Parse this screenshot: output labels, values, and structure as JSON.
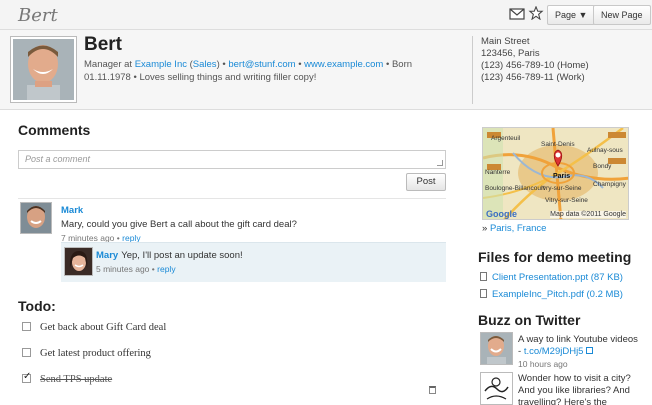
{
  "topbar": {
    "brand": "Bert",
    "page_label": "Page ▼",
    "new_page_label": "New Page"
  },
  "profile": {
    "name": "Bert",
    "role_prefix": "Manager at",
    "company": "Example Inc",
    "dept_open": "(",
    "department": "Sales",
    "dept_close": ")",
    "sep": "•",
    "email": "bert@stunf.com",
    "website": "www.example.com",
    "born_label": "• Born",
    "born_date": "01.11.1978",
    "tagline": "• Loves selling things and writing filler copy!"
  },
  "address": {
    "line1": "Main Street",
    "line2": "123456, Paris",
    "home": "(123) 456-789-10 (Home)",
    "work": "(123) 456-789-11 (Work)"
  },
  "comments": {
    "title": "Comments",
    "placeholder": "Post a comment",
    "post_label": "Post",
    "items": [
      {
        "author": "Mark",
        "text": "Mary, could you give Bert a call about the gift card deal?",
        "time": "7 minutes ago",
        "dot": "•",
        "reply": "reply"
      }
    ],
    "replies": [
      {
        "author": "Mary",
        "text": "Yep, I'll post an update soon!",
        "time": "5 minutes ago",
        "dot": "•",
        "reply": "reply"
      }
    ]
  },
  "todo": {
    "title": "Todo:",
    "items": [
      {
        "text": "Get back about Gift Card deal",
        "done": false
      },
      {
        "text": "Get latest product offering",
        "done": false
      },
      {
        "text": "Send TPS update",
        "done": true
      }
    ]
  },
  "map": {
    "labels": [
      "Argenteuil",
      "Saint-Denis",
      "Aulnay-sous",
      "Bondy",
      "Paris",
      "Boulogne-Billancourt",
      "Ivry-sur-Seine",
      "Vitry-sur-Seine",
      "Champigny",
      "Nanterre"
    ],
    "credit": "Map data ©2011 Google",
    "google": "Google",
    "location_prefix": "»",
    "location": "Paris, France"
  },
  "files": {
    "title": "Files for demo meeting",
    "items": [
      "Client Presentation.ppt (87 KB)",
      "ExampleInc_Pitch.pdf (0.2 MB)"
    ]
  },
  "buzz": {
    "title": "Buzz on Twitter",
    "tweets": [
      {
        "text": "A way to link Youtube videos -",
        "link": "t.co/M29jDHj5",
        "time": "10 hours ago"
      },
      {
        "text": "Wonder how to visit a city? And you like libraries? And travelling? Here's the"
      }
    ]
  },
  "colors": {
    "link": "#1a8ad6",
    "reply_bg": "#eaf2f6",
    "header_bg": "#f6f6f6"
  },
  "icons": [
    "envelope-icon",
    "star-icon",
    "file-icon",
    "trash-icon",
    "external-link-icon",
    "map-pin-icon"
  ]
}
